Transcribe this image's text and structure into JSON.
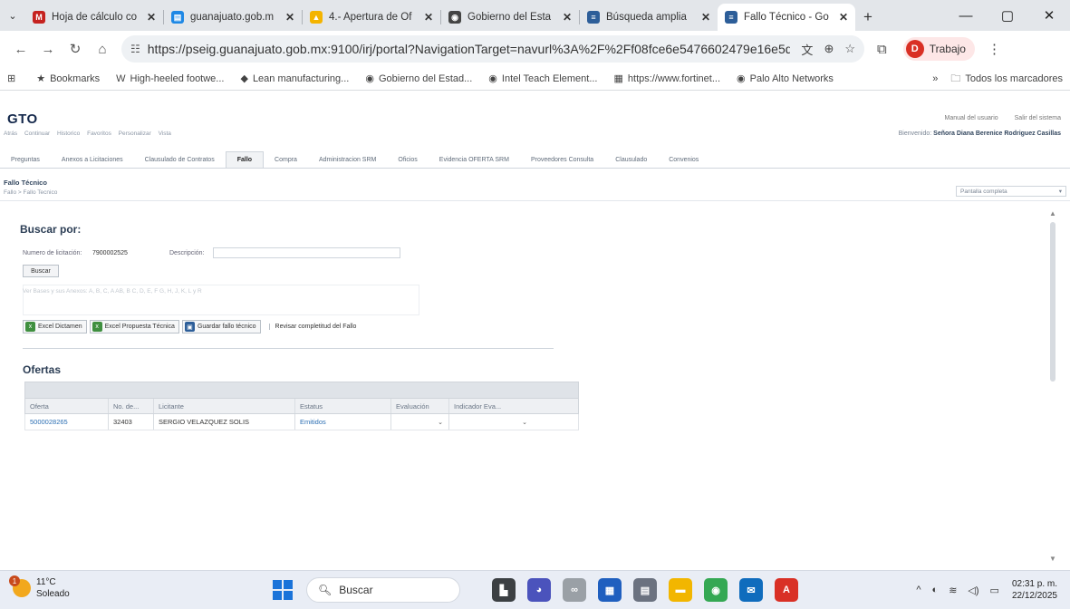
{
  "browser": {
    "tabs": [
      {
        "title": "Hoja de cálculo co",
        "favicon_color": "#c5221f",
        "favicon_glyph": "M",
        "active": false
      },
      {
        "title": "guanajuato.gob.m",
        "favicon_color": "#1e88e5",
        "favicon_glyph": "▤",
        "active": false
      },
      {
        "title": "4.- Apertura de Of",
        "favicon_color": "#f4b400",
        "favicon_glyph": "▲",
        "active": false
      },
      {
        "title": "Gobierno del Esta",
        "favicon_color": "#444444",
        "favicon_glyph": "◉",
        "active": false
      },
      {
        "title": "Búsqueda amplia",
        "favicon_color": "#2d5e99",
        "favicon_glyph": "≡",
        "active": false
      },
      {
        "title": "Fallo Técnico - Go",
        "favicon_color": "#2d5e99",
        "favicon_glyph": "≡",
        "active": true
      }
    ],
    "new_tab": "+",
    "url": "https://pseig.guanajuato.gob.mx:9100/irj/portal?NavigationTarget=navurl%3A%2F%2Ff08fce6e5476602479e16e5d121f7824...",
    "profile_initial": "D",
    "profile_label": "Trabajo",
    "bookmarks": [
      {
        "icon": "★",
        "label": "Bookmarks"
      },
      {
        "icon": "W",
        "label": "High-heeled footwe..."
      },
      {
        "icon": "◆",
        "label": "Lean manufacturing..."
      },
      {
        "icon": "◉",
        "label": "Gobierno del Estad..."
      },
      {
        "icon": "◉",
        "label": "Intel Teach Element..."
      },
      {
        "icon": "▦",
        "label": "https://www.fortinet..."
      },
      {
        "icon": "◉",
        "label": "Palo Alto Networks"
      }
    ],
    "bookmarks_more": "»",
    "all_bookmarks": "Todos los marcadores"
  },
  "portal": {
    "logo": "GTO",
    "manual": "Manual del usuario",
    "logout": "Salir del sistema",
    "history": [
      "Atrás",
      "Continuar",
      "Historico",
      "Favoritos",
      "Personalizar",
      "Vista"
    ],
    "welcome_prefix": "Bienvenido:",
    "welcome_user": "Señora Diana Berenice Rodriguez Casillas",
    "nav": [
      "Preguntas",
      "Anexos a Licitaciones",
      "Clausulado de Contratos",
      "Fallo",
      "Compra",
      "Administracion SRM",
      "Oficios",
      "Evidencia OFERTA SRM",
      "Proveedores Consulta",
      "Clausulado",
      "Convenios"
    ],
    "nav_active": "Fallo",
    "page_title": "Fallo Técnico",
    "breadcrumb": "Fallo  >  Fallo Tecnico",
    "fullscreen": "Pantalla completa"
  },
  "search": {
    "heading": "Buscar por:",
    "lic_label": "Numero de licitación:",
    "lic_value": "7900002525",
    "desc_label": "Descripción:",
    "desc_value": "",
    "button": "Buscar",
    "faded_line": "Ver Bases y sus Anexos:  A, B, C, A AB, B C, D, E, F G, H, J, K, L y R"
  },
  "actions": {
    "excel_dictamen": "Excel Dictamen",
    "excel_propuesta": "Excel Propuesta Técnica",
    "guardar": "Guardar fallo técnico",
    "revisar": "Revisar completitud del Fallo"
  },
  "offers": {
    "heading": "Ofertas",
    "columns": [
      "Oferta",
      "No. de...",
      "Licitante",
      "Estatus",
      "Evaluación",
      "Indicador Eva..."
    ],
    "rows": [
      {
        "oferta": "5000028265",
        "no": "32403",
        "licitante": "SERGIO VELAZQUEZ SOLIS",
        "estatus": "Emitidos",
        "evaluacion": "",
        "indicador": ""
      }
    ]
  },
  "taskbar": {
    "weather_temp": "11°C",
    "weather_desc": "Soleado",
    "weather_badge": "1",
    "search_placeholder": "Buscar",
    "time": "02:31 p. m.",
    "date": "22/12/2025",
    "apps": [
      {
        "name": "task-view",
        "color": "#3c4043",
        "glyph": "▙"
      },
      {
        "name": "teams",
        "color": "#4b53bc",
        "glyph": "◕"
      },
      {
        "name": "copilot",
        "color": "#9aa0a6",
        "glyph": "∞"
      },
      {
        "name": "store",
        "color": "#1f5fbf",
        "glyph": "▦"
      },
      {
        "name": "calculator",
        "color": "#6b7280",
        "glyph": "▤"
      },
      {
        "name": "file-explorer",
        "color": "#f2b600",
        "glyph": "▬"
      },
      {
        "name": "chrome",
        "color": "#34a853",
        "glyph": "◉"
      },
      {
        "name": "outlook",
        "color": "#0f6cbd",
        "glyph": "✉"
      },
      {
        "name": "acrobat",
        "color": "#d93025",
        "glyph": "A"
      }
    ]
  }
}
